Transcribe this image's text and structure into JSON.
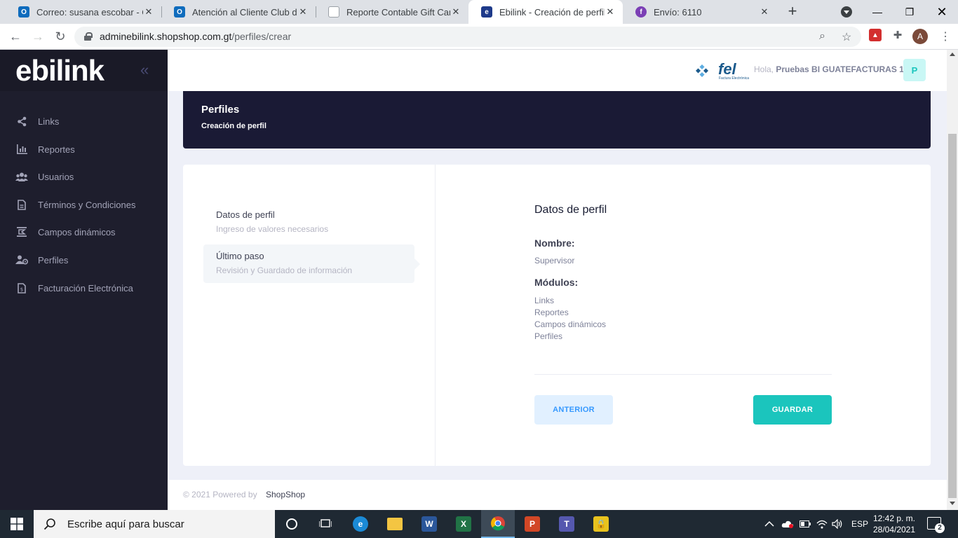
{
  "browser": {
    "tabs": [
      {
        "title": "Correo: susana escobar - Out",
        "favicon": "outlook-icon",
        "color": "#0f6cbd"
      },
      {
        "title": "Atención al Cliente Club de C",
        "favicon": "outlook-icon",
        "color": "#0f6cbd"
      },
      {
        "title": "Reporte Contable Gift Cards -",
        "favicon": "document-icon",
        "color": "#9aa0a6"
      },
      {
        "title": "Ebilink - Creación de perfil",
        "favicon": "ebilink-icon",
        "color": "#1e3a8a"
      },
      {
        "title": "Envío: 6110",
        "favicon": "facebook-icon",
        "color": "#7b3fb5"
      }
    ],
    "url_host": "adminebilink.shopshop.com.gt",
    "url_path": "/perfiles/crear",
    "profile_initial": "A"
  },
  "sidebar": {
    "brand": "ebilink",
    "collapse_glyph": "«",
    "items": [
      {
        "label": "Links",
        "icon": "share-icon"
      },
      {
        "label": "Reportes",
        "icon": "bar-chart-icon"
      },
      {
        "label": "Usuarios",
        "icon": "users-icon"
      },
      {
        "label": "Términos y Condiciones",
        "icon": "file-icon"
      },
      {
        "label": "Campos dinámicos",
        "icon": "dynamic-fields-icon"
      },
      {
        "label": "Perfiles",
        "icon": "profiles-icon"
      },
      {
        "label": "Facturación Electrónica",
        "icon": "invoice-icon"
      }
    ]
  },
  "topbar": {
    "fel_logo": "fel",
    "fel_sub": "Factura Electrónica",
    "greeting_prefix": "Hola,",
    "user_name": "Pruebas BI GUATEFACTURAS 1",
    "user_initial": "P"
  },
  "subheader": {
    "title": "Perfiles",
    "subtitle": "Creación de perfil"
  },
  "wizard": {
    "steps": [
      {
        "title": "Datos de perfil",
        "desc": "Ingreso de valores necesarios",
        "active": false
      },
      {
        "title": "Último paso",
        "desc": "Revisión y Guardado de información",
        "active": true
      }
    ],
    "review": {
      "title": "Datos de perfil",
      "name_label": "Nombre:",
      "name_value": "Supervisor",
      "modules_label": "Módulos:",
      "modules": [
        "Links",
        "Reportes",
        "Campos dinámicos",
        "Perfiles"
      ]
    },
    "prev_label": "ANTERIOR",
    "save_label": "GUARDAR"
  },
  "footer": {
    "copyright": "© 2021 Powered by",
    "link": "ShopShop"
  },
  "taskbar": {
    "search_placeholder": "Escribe aquí para buscar",
    "lang": "ESP",
    "time": "12:42 p. m.",
    "date": "28/04/2021",
    "notifications": "2"
  },
  "colors": {
    "sidebar_bg": "#1e1e2d",
    "header_bg": "#1a1a35",
    "accent_primary": "#3699ff",
    "accent_success": "#1bc5bd"
  }
}
